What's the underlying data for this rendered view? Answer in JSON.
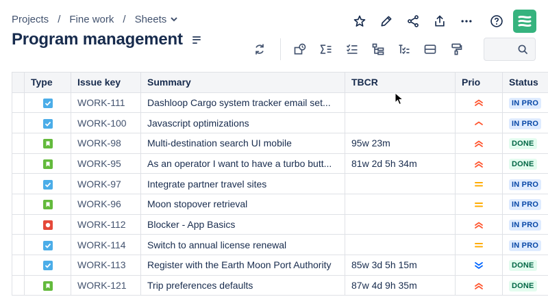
{
  "breadcrumb": {
    "items": [
      "Projects",
      "Fine work",
      "Sheets"
    ],
    "separator": "/"
  },
  "header": {
    "title": "Program management"
  },
  "colors": {
    "brand": "#36b37e",
    "prio_high": "#ff5630",
    "prio_medium": "#ffab00",
    "prio_low": "#0065ff",
    "task": "#4bade8",
    "story": "#63ba3c",
    "bug": "#e5493a"
  },
  "top_actions": [
    "star-icon",
    "edit-icon",
    "share-icon",
    "export-icon",
    "more-icon",
    "help-icon"
  ],
  "toolbar": [
    "refresh-icon",
    "add-field-icon",
    "sum-icon",
    "checklist-icon",
    "hierarchy-icon",
    "subtasks-icon",
    "rows-icon",
    "format-painter-icon"
  ],
  "table": {
    "columns": [
      "Type",
      "Issue key",
      "Summary",
      "TBCR",
      "Prio",
      "Status"
    ],
    "rows": [
      {
        "type": "task",
        "key": "WORK-111",
        "summary": "Dashloop Cargo system tracker email set...",
        "tbcr": "",
        "prio": "high",
        "status": "IN PRO",
        "status_kind": "inprog"
      },
      {
        "type": "task",
        "key": "WORK-100",
        "summary": "Javascript optimizations",
        "tbcr": "",
        "prio": "high-single",
        "status": "IN PRO",
        "status_kind": "inprog"
      },
      {
        "type": "story",
        "key": "WORK-98",
        "summary": "Multi-destination search UI mobile",
        "tbcr": "95w 23m",
        "prio": "high",
        "status": "DONE",
        "status_kind": "done"
      },
      {
        "type": "story",
        "key": "WORK-95",
        "summary": "As an operator I want to have a turbo butt...",
        "tbcr": "81w 2d 5h 34m",
        "prio": "high",
        "status": "DONE",
        "status_kind": "done"
      },
      {
        "type": "task",
        "key": "WORK-97",
        "summary": "Integrate partner travel sites",
        "tbcr": "",
        "prio": "medium",
        "status": "IN PRO",
        "status_kind": "inprog"
      },
      {
        "type": "story",
        "key": "WORK-96",
        "summary": "Moon stopover retrieval",
        "tbcr": "",
        "prio": "medium",
        "status": "IN PRO",
        "status_kind": "inprog"
      },
      {
        "type": "bug",
        "key": "WORK-112",
        "summary": "Blocker - App Basics",
        "tbcr": "",
        "prio": "high",
        "status": "IN PRO",
        "status_kind": "inprog"
      },
      {
        "type": "task",
        "key": "WORK-114",
        "summary": "Switch to annual license renewal",
        "tbcr": "",
        "prio": "medium",
        "status": "IN PRO",
        "status_kind": "inprog"
      },
      {
        "type": "task",
        "key": "WORK-113",
        "summary": "Register with the Earth Moon Port Authority",
        "tbcr": "85w 3d 5h 15m",
        "prio": "low",
        "status": "DONE",
        "status_kind": "done"
      },
      {
        "type": "story",
        "key": "WORK-121",
        "summary": "Trip preferences defaults",
        "tbcr": "87w 4d 9h 35m",
        "prio": "high",
        "status": "DONE",
        "status_kind": "done"
      }
    ]
  }
}
